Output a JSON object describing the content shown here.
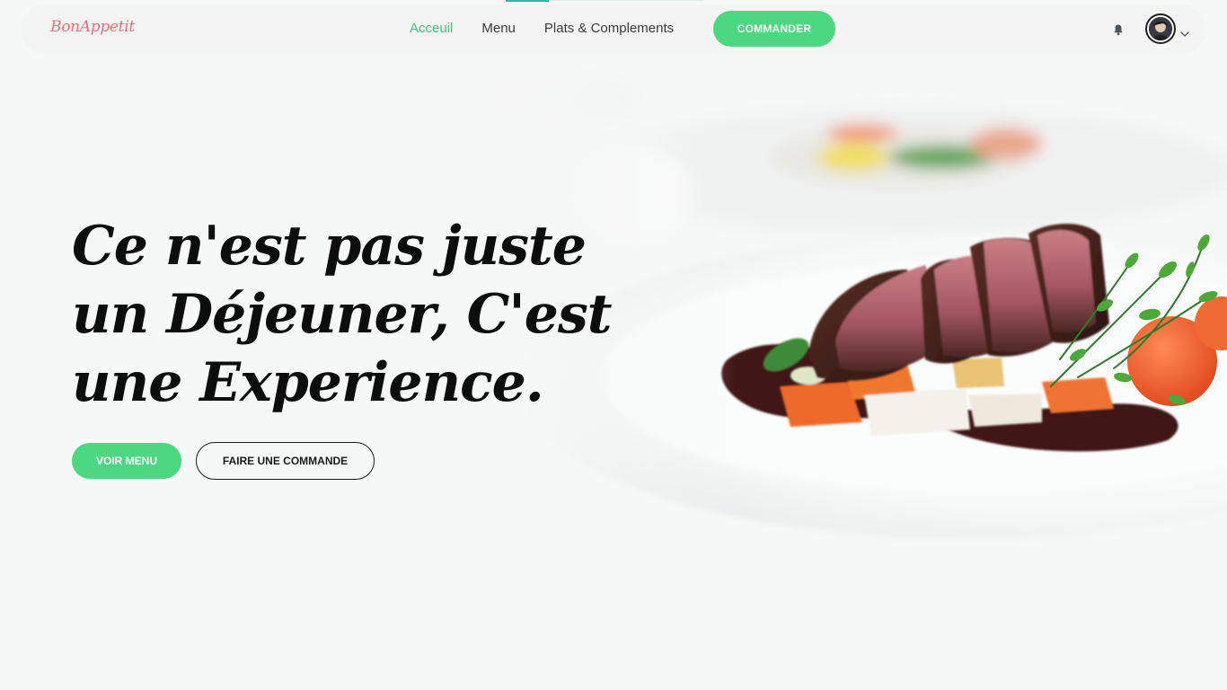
{
  "brand": {
    "name": "BonAppetit",
    "color": "#ee6e73"
  },
  "nav": {
    "links": [
      {
        "label": "Acceuil",
        "active": true
      },
      {
        "label": "Menu",
        "active": false
      },
      {
        "label": "Plats & Complements",
        "active": false
      }
    ],
    "cta_label": "COMMANDER",
    "icons": [
      "bell-icon",
      "avatar",
      "chevron-down-icon"
    ]
  },
  "hero": {
    "headline_lines": [
      "Ce n'est pas juste",
      "un Déjeuner, C'est",
      "une Experience."
    ],
    "primary_button": "VOIR MENU",
    "secondary_button": "FAIRE UNE COMMANDE",
    "image": "plated-steak-with-vegetables"
  },
  "colors": {
    "accent": "#4cd880",
    "active_link": "#3ec97b",
    "text": "#0d0d0d",
    "background": "#f6f7f7"
  }
}
